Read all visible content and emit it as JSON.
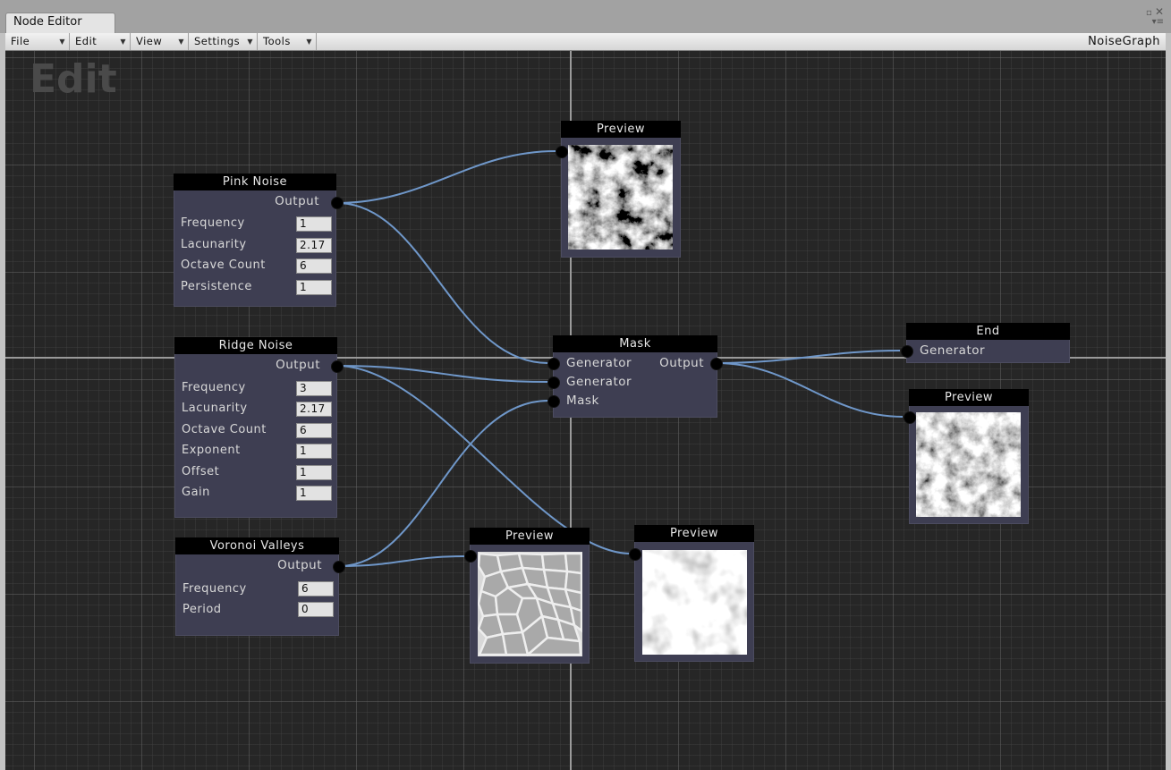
{
  "window": {
    "tab_title": "Node Editor",
    "graph_name": "NoiseGraph"
  },
  "menus": [
    {
      "label": "File"
    },
    {
      "label": "Edit"
    },
    {
      "label": "View"
    },
    {
      "label": "Settings"
    },
    {
      "label": "Tools"
    }
  ],
  "canvas": {
    "mode_label": "Edit"
  },
  "nodes": {
    "pink_noise": {
      "title": "Pink Noise",
      "output_label": "Output",
      "fields": [
        {
          "label": "Frequency",
          "value": "1"
        },
        {
          "label": "Lacunarity",
          "value": "2.17"
        },
        {
          "label": "Octave Count",
          "value": "6"
        },
        {
          "label": "Persistence",
          "value": "1"
        }
      ]
    },
    "ridge_noise": {
      "title": "Ridge Noise",
      "output_label": "Output",
      "fields": [
        {
          "label": "Frequency",
          "value": "3"
        },
        {
          "label": "Lacunarity",
          "value": "2.17"
        },
        {
          "label": "Octave Count",
          "value": "6"
        },
        {
          "label": "Exponent",
          "value": "1"
        },
        {
          "label": "Offset",
          "value": "1"
        },
        {
          "label": "Gain",
          "value": "1"
        }
      ]
    },
    "voronoi": {
      "title": "Voronoi Valleys",
      "output_label": "Output",
      "fields": [
        {
          "label": "Frequency",
          "value": "6"
        },
        {
          "label": "Period",
          "value": "0"
        }
      ]
    },
    "mask": {
      "title": "Mask",
      "inputs": [
        "Generator",
        "Generator",
        "Mask"
      ],
      "output_label": "Output"
    },
    "end": {
      "title": "End",
      "input_label": "Generator"
    },
    "preview_top": {
      "title": "Preview"
    },
    "preview_right": {
      "title": "Preview"
    },
    "preview_voronoi": {
      "title": "Preview"
    },
    "preview_ridge": {
      "title": "Preview"
    }
  },
  "colors": {
    "canvas_bg": "#262626",
    "node_bg": "#3e3e52",
    "title_bg": "#000000",
    "wire": "#6f97c9",
    "port": "#000000",
    "value_box": "#e2e2e2",
    "axis": "#9a9a9a"
  },
  "icons": {
    "window_controls": [
      "maximize-icon",
      "close-icon",
      "menu-icon"
    ],
    "menu_dropdown": "chevron-down-icon"
  }
}
